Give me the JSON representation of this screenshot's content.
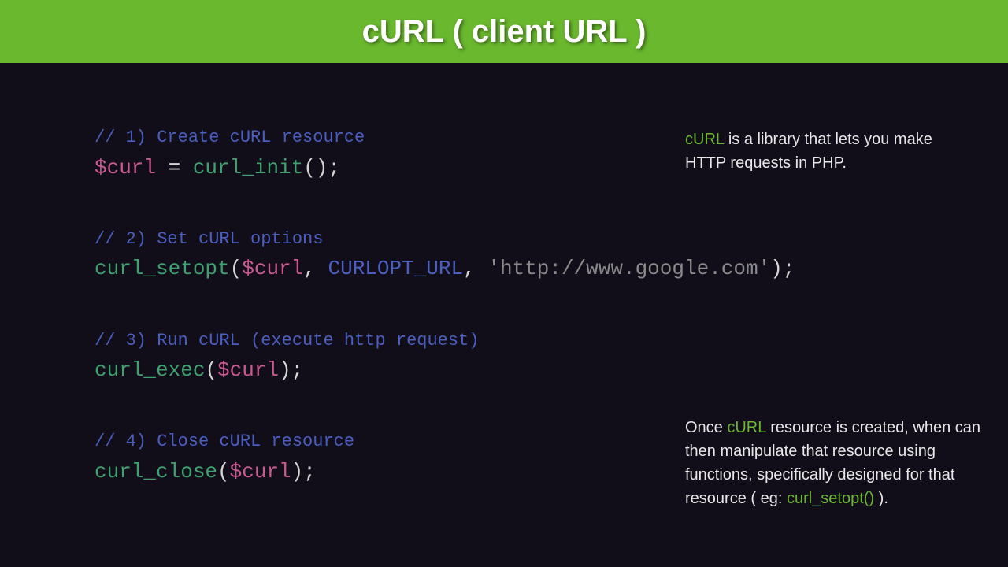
{
  "header": {
    "title": "cURL ( client URL )"
  },
  "code": {
    "block1": {
      "comment": "// 1) Create cURL resource",
      "var": "$curl",
      "eq": " = ",
      "func": "curl_init",
      "paren": "();"
    },
    "block2": {
      "comment": "// 2) Set cURL options",
      "func": "curl_setopt",
      "lp": "(",
      "var": "$curl",
      "comma1": ", ",
      "const": "CURLOPT_URL",
      "comma2": ", ",
      "str": "'http://www.google.com'",
      "rp": ");"
    },
    "block3": {
      "comment": "// 3) Run cURL (execute http request)",
      "func": "curl_exec",
      "lp": "(",
      "var": "$curl",
      "rp": ");"
    },
    "block4": {
      "comment": "// 4) Close cURL resource",
      "func": "curl_close",
      "lp": "(",
      "var": "$curl",
      "rp": ");"
    }
  },
  "notes": {
    "n1": {
      "hl": "cURL",
      "rest": " is a library that lets you make HTTP requests in PHP."
    },
    "n2": {
      "pre": "Once ",
      "hl1": "cURL",
      "mid": " resource is created, when can then manipulate that resource using functions, specifically designed for that resource ( eg: ",
      "hl2": "curl_setopt()",
      "post": " )."
    }
  }
}
